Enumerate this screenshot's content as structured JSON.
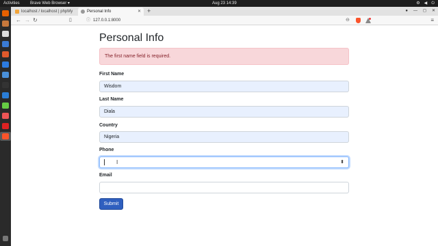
{
  "topbar": {
    "activities": "Activities",
    "app_menu": "Brave Web Browser ▾",
    "clock": "Aug 23  14:39"
  },
  "tabs": [
    {
      "label": "localhost / localhost | phpMy",
      "active": false
    },
    {
      "label": "Personal Info",
      "active": true
    }
  ],
  "toolbar": {
    "url": "127.0.0.1:8000"
  },
  "page": {
    "title": "Personal Info",
    "alert": "The first name field is required.",
    "fields": [
      {
        "label": "First Name",
        "value": "Wisdom"
      },
      {
        "label": "Last Name",
        "value": "Diala"
      },
      {
        "label": "Country",
        "value": "Nigeria"
      },
      {
        "label": "Phone",
        "value": ""
      },
      {
        "label": "Email",
        "value": ""
      }
    ],
    "submit_label": "Submit"
  },
  "colors": {
    "accent": "#2f5fbf",
    "alert_bg": "#f8d7da",
    "alert_text": "#842029",
    "autofill_bg": "#e8f0fe"
  }
}
